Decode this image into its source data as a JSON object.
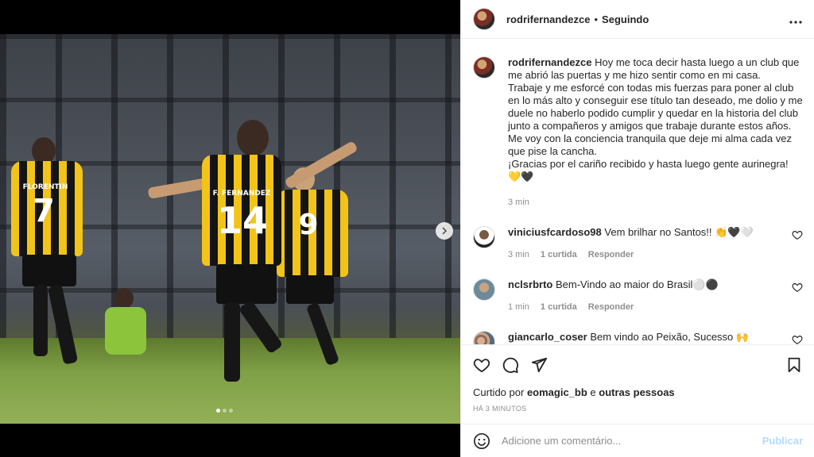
{
  "post": {
    "username": "rodrifernandezce",
    "follow_status": "Seguindo",
    "separator": "•",
    "caption": "Hoy me toca decir hasta luego a un club que me abrió las puertas y me hizo sentir como en mi casa.\nTrabaje y me esforcé con todas mis fuerzas para poner al club en lo más alto y conseguir ese título tan deseado, me dolio y me duele no haberlo podido cumplir y quedar en la historia del club junto a compañeros y amigos que trabaje durante estos años. Me voy con la conciencia tranquila que deje mi alma cada vez que pise la cancha.\n¡Gracias por el cariño recibido y hasta luego gente aurinegra! 💛🖤",
    "caption_time": "3 min"
  },
  "photo": {
    "numbers": [
      "7",
      "14",
      "9"
    ],
    "names": [
      "FLORENTIN",
      "F. FERNANDEZ",
      ""
    ]
  },
  "comments": [
    {
      "user": "viniciusfcardoso98",
      "text": "Vem brilhar no Santos!! 👏🖤🤍",
      "time": "3 min",
      "likes": "1 curtida",
      "reply": "Responder"
    },
    {
      "user": "nclsrbrto",
      "text": "Bem-Vindo ao maior do Brasil⚪⚫",
      "time": "1 min",
      "likes": "1 curtida",
      "reply": "Responder"
    },
    {
      "user": "giancarlo_coser",
      "text": "Bem vindo ao Peixão, Sucesso 🙌"
    }
  ],
  "likes": {
    "prefix": "Curtido por",
    "user": "eomagic_bb",
    "connector": "e",
    "others": "outras pessoas"
  },
  "timestamp": "HÁ 3 MINUTOS",
  "composer": {
    "placeholder": "Adicione um comentário...",
    "publish": "Publicar"
  },
  "colors": {
    "publish_disabled": "#b3dbff",
    "muted": "#8e8e8e",
    "kit_yellow": "#f2c418"
  },
  "icons": [
    "heart-icon",
    "comment-icon",
    "share-icon",
    "bookmark-icon",
    "emoji-icon",
    "more-options-icon",
    "chevron-right-icon"
  ]
}
